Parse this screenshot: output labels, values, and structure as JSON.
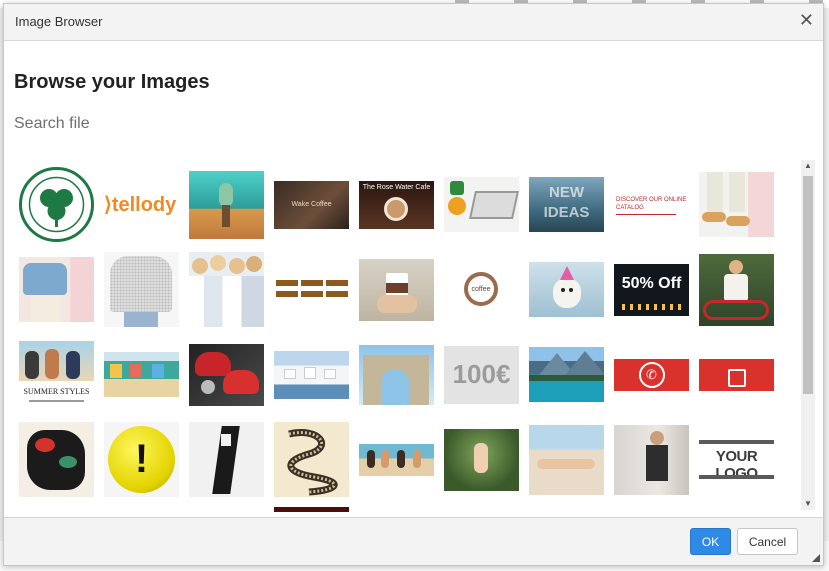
{
  "dialog": {
    "title": "Image Browser",
    "heading": "Browse your Images",
    "search_placeholder": "Search file",
    "ok_label": "OK",
    "cancel_label": "Cancel"
  },
  "thumbnails": [
    {
      "text": "ΠΑΝΑΘΗΝΑΪΚΟΣ 1908",
      "name": "shamrock-crest"
    },
    {
      "text": "tellody",
      "name": "tellody-logo"
    },
    {
      "text": "",
      "name": "cartoon-scene"
    },
    {
      "text": "Wake Coffee",
      "name": "coffee-sign"
    },
    {
      "text": "The Rose Water Cafe",
      "name": "latte-banner"
    },
    {
      "text": "",
      "name": "desk-laptop"
    },
    {
      "text": "NEW IDEAS",
      "name": "new-ideas"
    },
    {
      "text": "DISCOVER OUR ONLINE CATALOG",
      "name": "catalog-banner"
    },
    {
      "text": "",
      "name": "sneakers"
    },
    {
      "text": "",
      "name": "fashion-off-shoulder"
    },
    {
      "text": "",
      "name": "grey-sweater"
    },
    {
      "text": "",
      "name": "group-photo"
    },
    {
      "text": "",
      "name": "menu-buttons"
    },
    {
      "text": "",
      "name": "coffee-cup-hand"
    },
    {
      "text": "coffee",
      "name": "coffee-stamp"
    },
    {
      "text": "",
      "name": "party-dog"
    },
    {
      "text": "50% Off",
      "name": "fifty-off"
    },
    {
      "text": "",
      "name": "woman-with-bike"
    },
    {
      "text": "SUMMER STYLES",
      "name": "summer-styles"
    },
    {
      "text": "",
      "name": "colorful-shop"
    },
    {
      "text": "",
      "name": "red-scooters"
    },
    {
      "text": "",
      "name": "santorini"
    },
    {
      "text": "",
      "name": "stone-arch"
    },
    {
      "text": "100€",
      "name": "hundred-euro"
    },
    {
      "text": "",
      "name": "mountain-lake"
    },
    {
      "text": "",
      "name": "phone-button"
    },
    {
      "text": "",
      "name": "shopping-button"
    },
    {
      "text": "",
      "name": "tiger-art"
    },
    {
      "text": "!",
      "name": "warning-sign"
    },
    {
      "text": "",
      "name": "black-figure"
    },
    {
      "text": "",
      "name": "snake-drawing"
    },
    {
      "text": "",
      "name": "beach-group"
    },
    {
      "text": "",
      "name": "woman-in-grass"
    },
    {
      "text": "",
      "name": "woman-on-beach"
    },
    {
      "text": "",
      "name": "woman-mirror"
    },
    {
      "text": "YOUR LOGO",
      "name": "your-logo"
    },
    {
      "text": "",
      "name": "dark-red-partial"
    }
  ]
}
